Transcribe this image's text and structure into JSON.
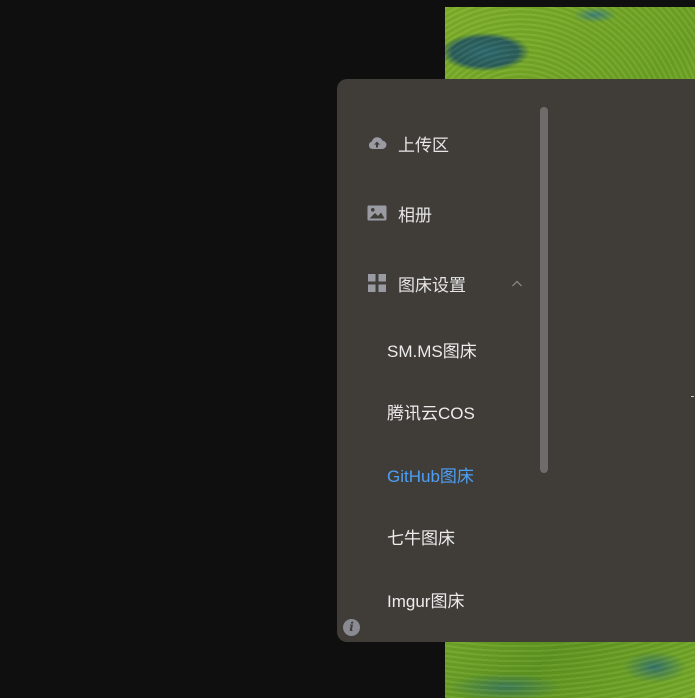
{
  "sidebar": {
    "items": [
      {
        "label": "上传区",
        "icon": "cloud-upload-icon"
      },
      {
        "label": "相册",
        "icon": "image-icon"
      },
      {
        "label": "图床设置",
        "icon": "grid-icon",
        "expanded": true
      }
    ],
    "sub_items": [
      {
        "label": "SM.MS图床",
        "active": false
      },
      {
        "label": "腾讯云COS",
        "active": false
      },
      {
        "label": "GitHub图床",
        "active": true
      },
      {
        "label": "七牛图床",
        "active": false
      },
      {
        "label": "Imgur图床",
        "active": false
      }
    ]
  },
  "footer": {
    "info_icon": "info-icon",
    "info_glyph": "i"
  },
  "colors": {
    "panel_bg": "#403d39",
    "active": "#4d9ff5",
    "text": "#e6e6e6",
    "icon": "#9a9aa3"
  }
}
